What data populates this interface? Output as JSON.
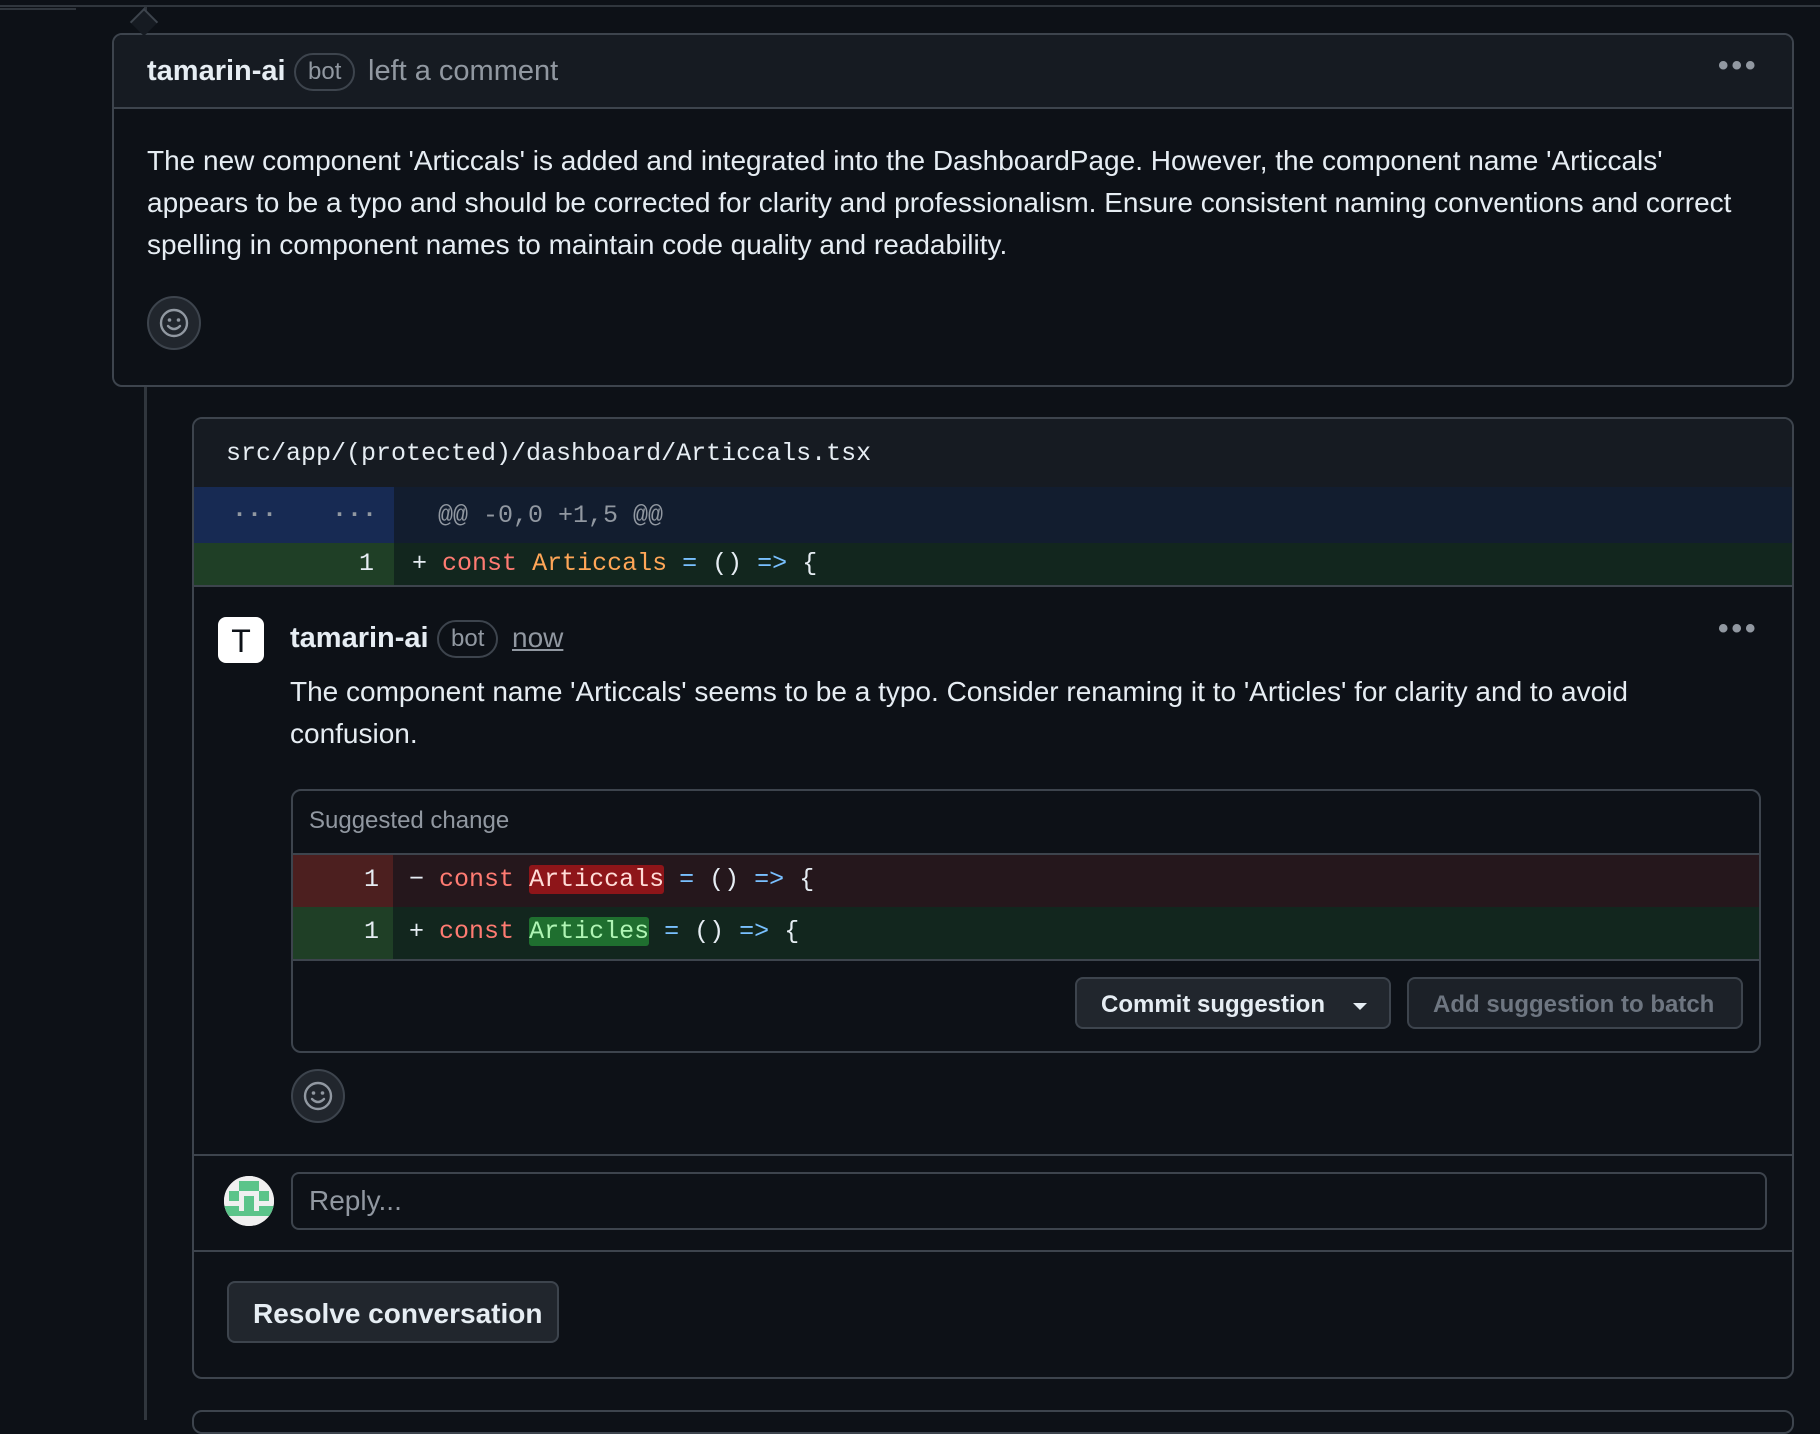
{
  "review_comment": {
    "author": "tamarin-ai",
    "badge": "bot",
    "action": "left a comment",
    "body": "The new component 'Articcals' is added and integrated into the DashboardPage. However, the component name 'Articcals' appears to be a typo and should be corrected for clarity and professionalism. Ensure consistent naming conventions and correct spelling in component names to maintain code quality and readability.",
    "menu_icon": "kebab-horizontal-icon",
    "reaction_icon": "smiley-icon"
  },
  "file": {
    "path": "src/app/(protected)/dashboard/Articcals.tsx",
    "hunk": {
      "old_num": "...",
      "new_num": "...",
      "header": "@@ -0,0 +1,5 @@"
    },
    "line": {
      "num": "1",
      "sign": "+",
      "kw": "const",
      "name": "Articcals",
      "eq": "=",
      "parens": "()",
      "arrow": "=>",
      "brace": "{"
    }
  },
  "inline_comment": {
    "avatar_letter": "T",
    "author": "tamarin-ai",
    "badge": "bot",
    "time": "now",
    "body": "The component name 'Articcals' seems to be a typo. Consider renaming it to 'Articles' for clarity and to avoid confusion.",
    "suggestion": {
      "title": "Suggested change",
      "removed": {
        "num": "1",
        "sign": "−",
        "kw": "const",
        "name": "Articcals",
        "eq": "=",
        "parens": "()",
        "arrow": "=>",
        "brace": "{"
      },
      "added": {
        "num": "1",
        "sign": "+",
        "kw": "const",
        "name": "Articles",
        "eq": "=",
        "parens": "()",
        "arrow": "=>",
        "brace": "{"
      },
      "commit_label": "Commit suggestion",
      "batch_label": "Add suggestion to batch"
    }
  },
  "reply": {
    "placeholder": "Reply..."
  },
  "resolve_label": "Resolve conversation",
  "colors": {
    "background": "#0d1117",
    "border": "#3d444d",
    "addition": "#12261e",
    "deletion": "#25171c",
    "hunk": "#121d2f"
  }
}
